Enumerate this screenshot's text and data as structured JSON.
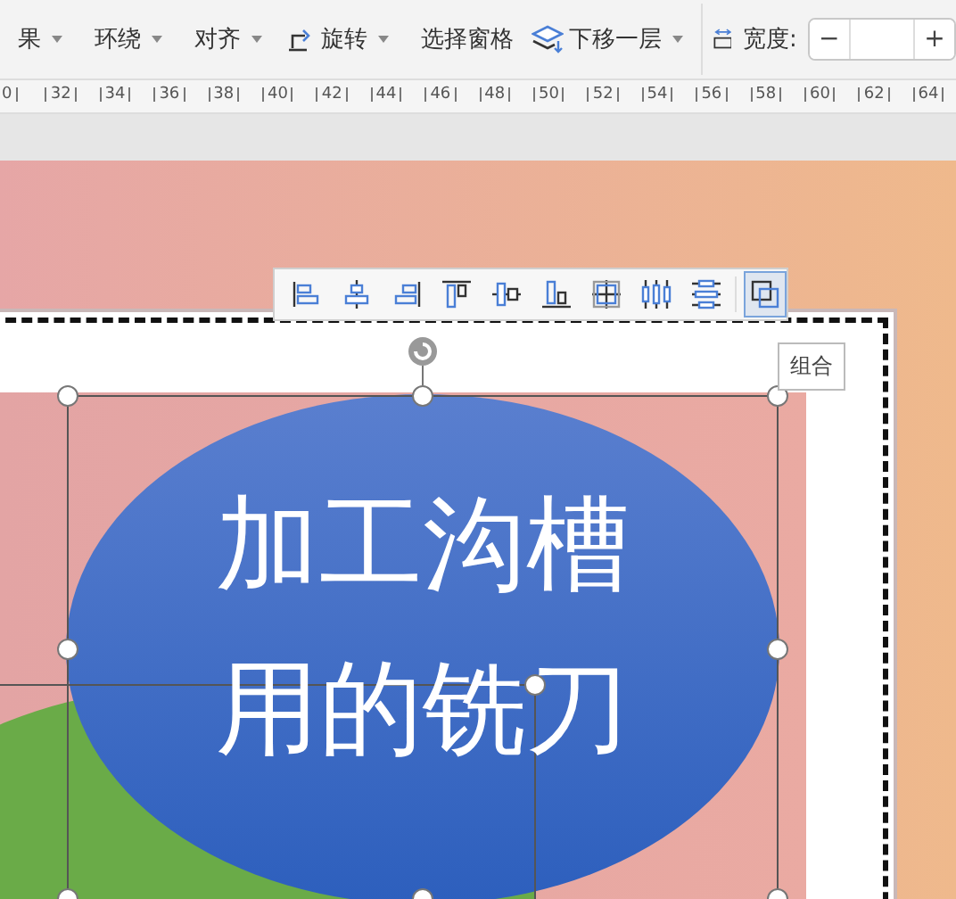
{
  "ribbon": {
    "items": [
      {
        "kind": "plain",
        "label": "果",
        "dropdown": true
      },
      {
        "kind": "plain",
        "label": "环绕",
        "dropdown": true
      },
      {
        "kind": "plain",
        "label": "对齐",
        "dropdown": true
      },
      {
        "kind": "rotate",
        "label": "旋转",
        "dropdown": true
      },
      {
        "kind": "plain",
        "label": "选择窗格",
        "dropdown": false
      },
      {
        "kind": "layers",
        "label": "下移一层",
        "dropdown": true
      }
    ],
    "width_field": {
      "label": "宽度:",
      "minus": "−",
      "plus": "+"
    }
  },
  "ruler": {
    "labels": [
      "0",
      "32",
      "34",
      "36",
      "38",
      "40",
      "42",
      "44",
      "46",
      "48",
      "50",
      "52",
      "54",
      "56",
      "58",
      "60",
      "62",
      "64"
    ]
  },
  "align_toolbar": {
    "buttons": [
      {
        "kind": "left",
        "selected": false
      },
      {
        "kind": "hcenter",
        "selected": false
      },
      {
        "kind": "right",
        "selected": false
      },
      {
        "kind": "top",
        "selected": false
      },
      {
        "kind": "vmiddle",
        "selected": false
      },
      {
        "kind": "bottom",
        "selected": false
      },
      {
        "kind": "center",
        "selected": false
      },
      {
        "kind": "hdist",
        "selected": false
      },
      {
        "kind": "vdist",
        "selected": false
      },
      {
        "kind": "group",
        "selected": true
      }
    ]
  },
  "tooltip": {
    "text": "组合"
  },
  "slide": {
    "shape_text": [
      "加工沟槽",
      "用的铣刀"
    ]
  }
}
